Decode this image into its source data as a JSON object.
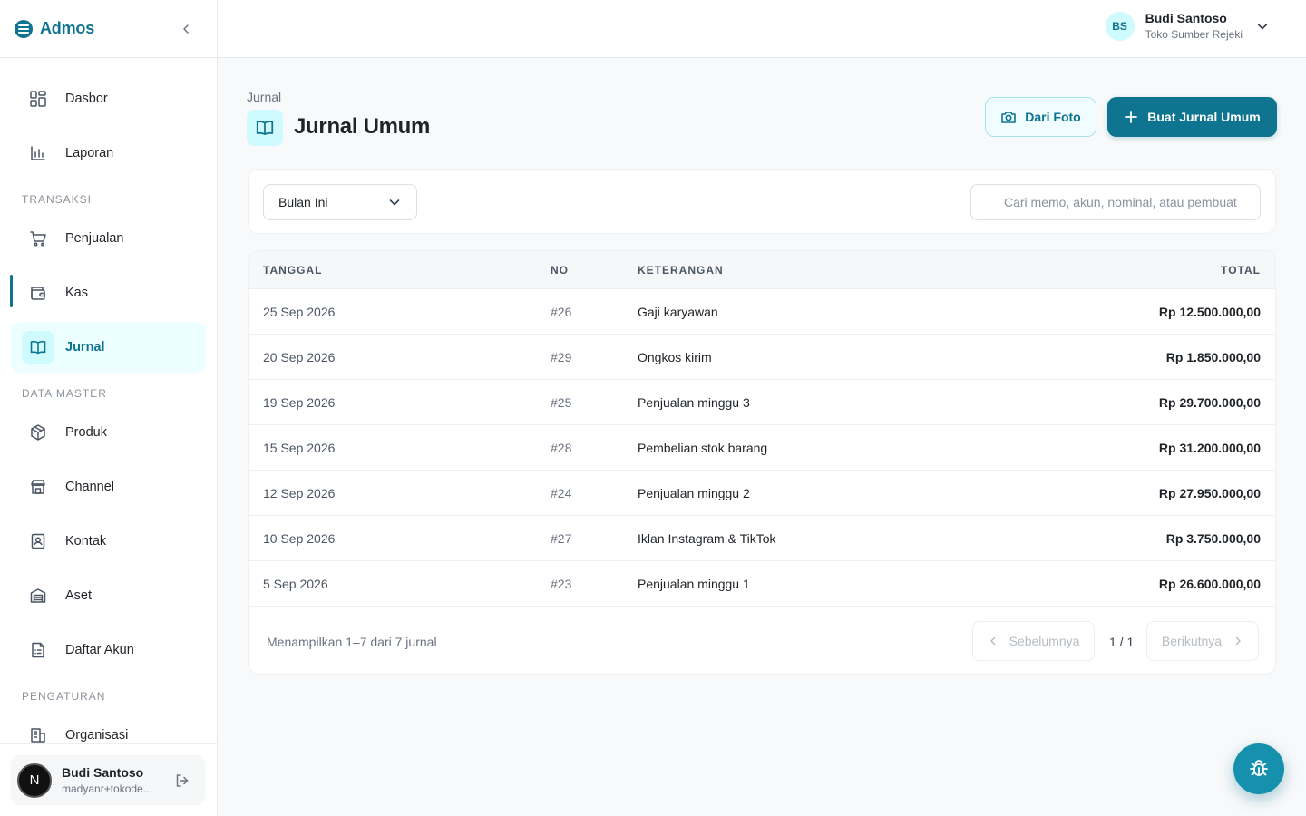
{
  "app": {
    "name": "Admos"
  },
  "sidebar": {
    "items": [
      {
        "label": "Dasbor"
      },
      {
        "label": "Laporan"
      },
      {
        "label": "Penjualan"
      },
      {
        "label": "Kas"
      },
      {
        "label": "Jurnal"
      },
      {
        "label": "Produk"
      },
      {
        "label": "Channel"
      },
      {
        "label": "Kontak"
      },
      {
        "label": "Aset"
      },
      {
        "label": "Daftar Akun"
      },
      {
        "label": "Organisasi"
      }
    ],
    "sections": {
      "transaksi": "TRANSAKSI",
      "data_master": "DATA MASTER",
      "pengaturan": "PENGATURAN"
    },
    "user": {
      "initial": "N",
      "name": "Budi Santoso",
      "email": "madyanr+tokode..."
    }
  },
  "topbar": {
    "profile": {
      "initials": "BS",
      "name": "Budi Santoso",
      "org": "Toko Sumber Rejeki"
    }
  },
  "page": {
    "breadcrumb": "Jurnal",
    "title": "Jurnal Umum",
    "btn_photo": "Dari Foto",
    "btn_create": "Buat Jurnal Umum"
  },
  "filters": {
    "period": "Bulan Ini",
    "search_placeholder": "Cari memo, akun, nominal, atau pembuat"
  },
  "table": {
    "columns": {
      "date": "TANGGAL",
      "no": "NO",
      "desc": "KETERANGAN",
      "total": "TOTAL"
    },
    "rows": [
      {
        "date": "25 Sep 2026",
        "no": "#26",
        "desc": "Gaji karyawan",
        "total": "Rp 12.500.000,00"
      },
      {
        "date": "20 Sep 2026",
        "no": "#29",
        "desc": "Ongkos kirim",
        "total": "Rp 1.850.000,00"
      },
      {
        "date": "19 Sep 2026",
        "no": "#25",
        "desc": "Penjualan minggu 3",
        "total": "Rp 29.700.000,00"
      },
      {
        "date": "15 Sep 2026",
        "no": "#28",
        "desc": "Pembelian stok barang",
        "total": "Rp 31.200.000,00"
      },
      {
        "date": "12 Sep 2026",
        "no": "#24",
        "desc": "Penjualan minggu 2",
        "total": "Rp 27.950.000,00"
      },
      {
        "date": "10 Sep 2026",
        "no": "#27",
        "desc": "Iklan Instagram & TikTok",
        "total": "Rp 3.750.000,00"
      },
      {
        "date": "5 Sep 2026",
        "no": "#23",
        "desc": "Penjualan minggu 1",
        "total": "Rp 26.600.000,00"
      }
    ]
  },
  "pagination": {
    "info": "Menampilkan 1–7 dari 7 jurnal",
    "prev": "Sebelumnya",
    "page": "1 / 1",
    "next": "Berikutnya"
  },
  "colors": {
    "accent": "#0e7490",
    "accent_light": "#cffafe",
    "fab": "#1590ad"
  }
}
